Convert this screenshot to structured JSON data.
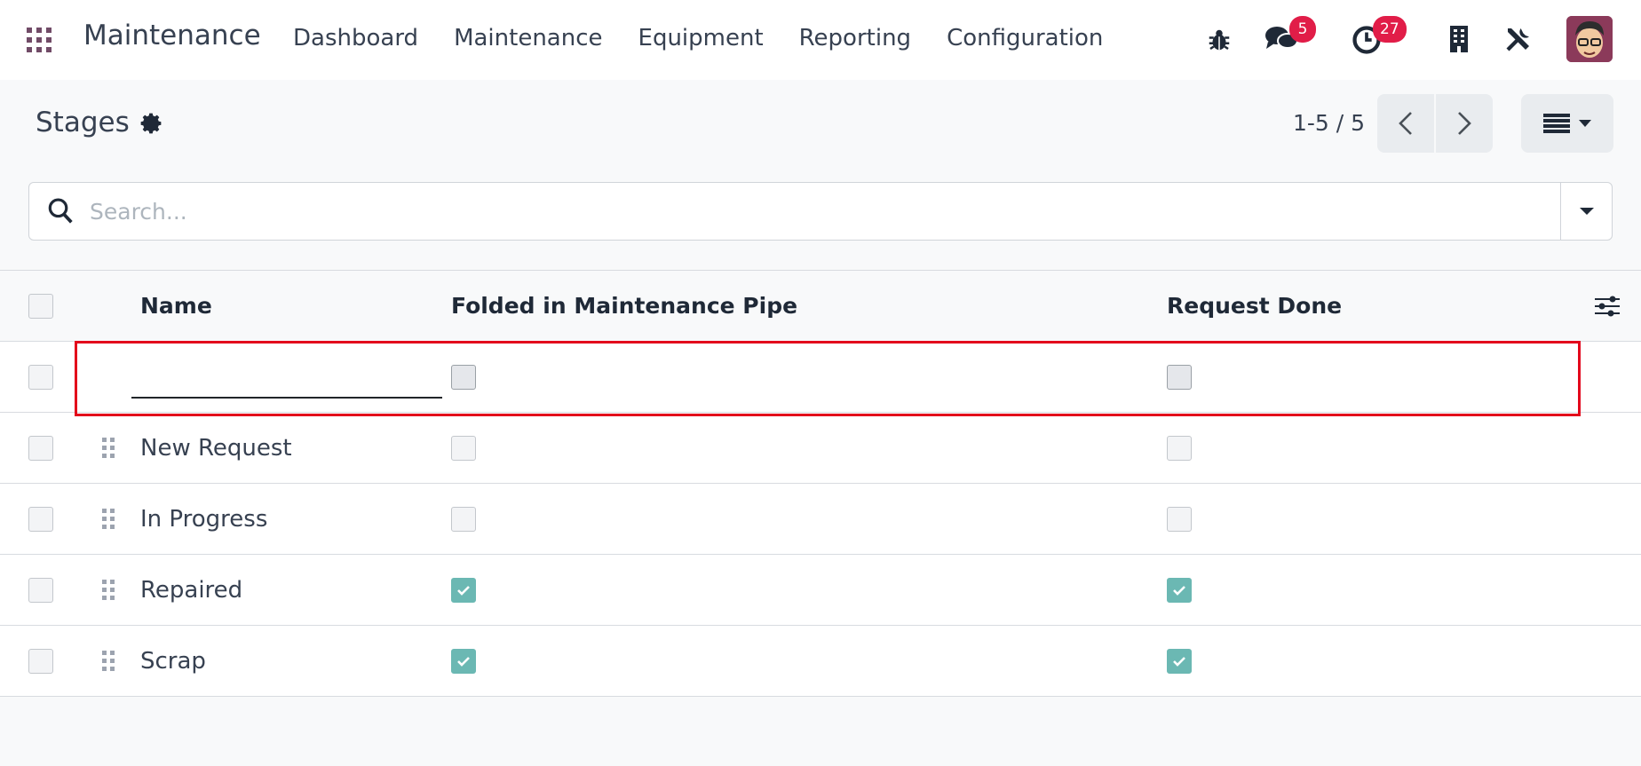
{
  "app": {
    "name": "Maintenance"
  },
  "menu": [
    "Dashboard",
    "Maintenance",
    "Equipment",
    "Reporting",
    "Configuration"
  ],
  "systray": {
    "messages_count": "5",
    "activities_count": "27"
  },
  "page": {
    "title": "Stages"
  },
  "pager": {
    "value": "1-5 / 5"
  },
  "search": {
    "placeholder": "Search..."
  },
  "table": {
    "headers": {
      "name": "Name",
      "folded": "Folded in Maintenance Pipe",
      "done": "Request Done"
    },
    "rows": [
      {
        "name": "New Request",
        "folded": false,
        "done": false
      },
      {
        "name": "In Progress",
        "folded": false,
        "done": false
      },
      {
        "name": "Repaired",
        "folded": true,
        "done": true
      },
      {
        "name": "Scrap",
        "folded": true,
        "done": true
      }
    ]
  },
  "colors": {
    "brand": "#714b67",
    "badge": "#e11d48",
    "check": "#6bb8b3",
    "highlight": "#e3051b"
  }
}
